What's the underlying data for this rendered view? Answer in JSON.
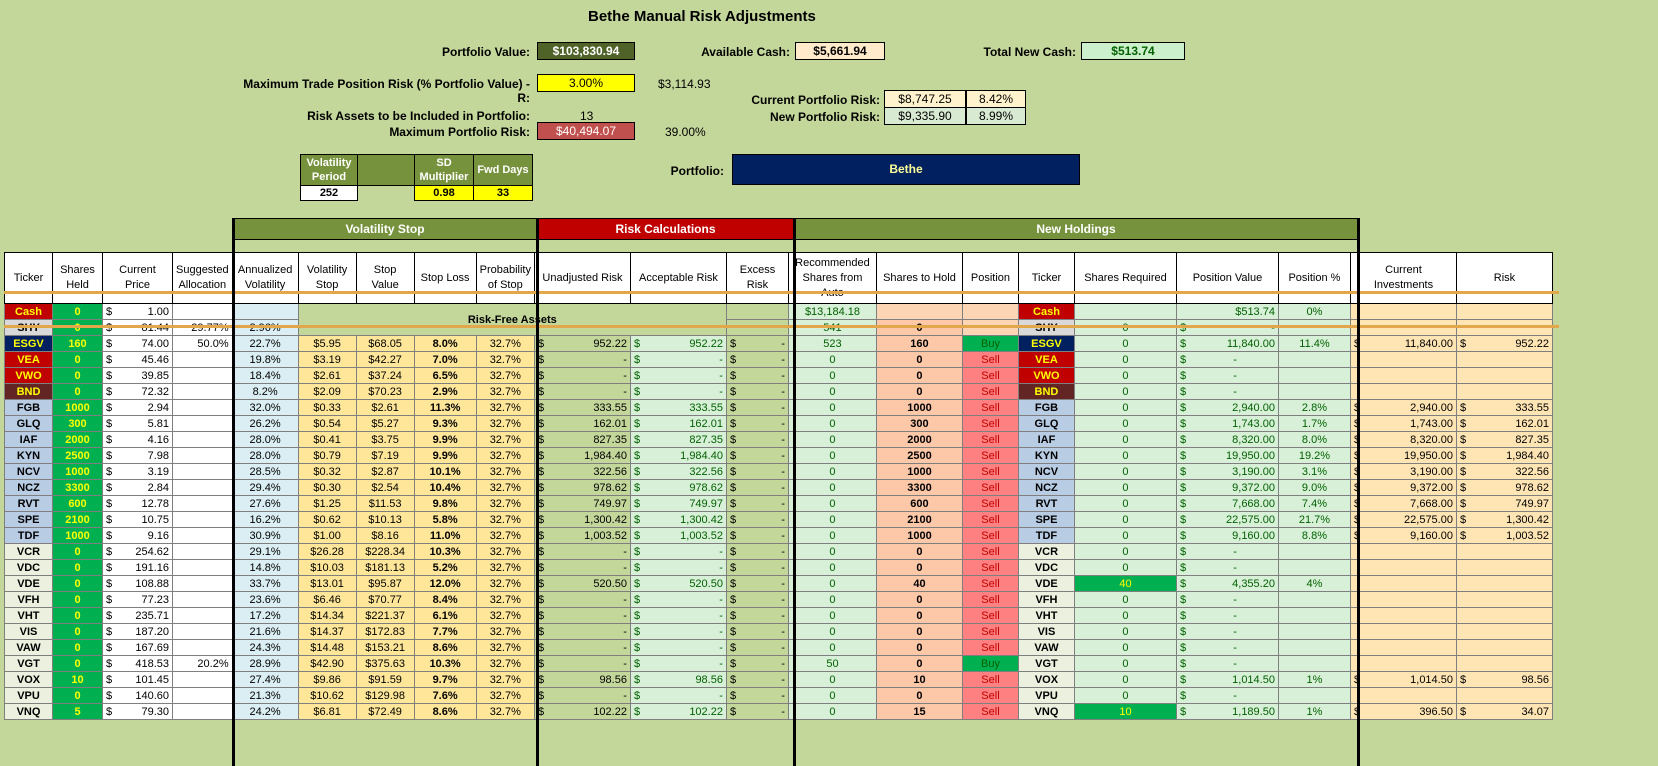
{
  "title": "Bethe Manual Risk Adjustments",
  "summary": {
    "portfolio_value_label": "Portfolio Value:",
    "portfolio_value": "$103,830.94",
    "available_cash_label": "Available Cash:",
    "available_cash": "$5,661.94",
    "total_new_cash_label": "Total New Cash:",
    "total_new_cash": "$513.74",
    "max_trade_risk_label": "Maximum Trade Position Risk (% Portfolio Value) - R:",
    "max_trade_risk_pct": "3.00%",
    "max_trade_risk_amt": "$3,114.93",
    "current_risk_label": "Current Portfolio Risk:",
    "current_risk_amt": "$8,747.25",
    "current_risk_pct": "8.42%",
    "new_risk_label": "New Portfolio Risk:",
    "new_risk_amt": "$9,335.90",
    "new_risk_pct": "8.99%",
    "risk_assets_label": "Risk Assets to be Included in Portfolio:",
    "risk_assets_count": "13",
    "max_portfolio_risk_label": "Maximum Portfolio Risk:",
    "max_portfolio_risk_amt": "$40,494.07",
    "max_portfolio_risk_pct": "39.00%",
    "portfolio_label": "Portfolio:",
    "portfolio_name": "Bethe"
  },
  "params": {
    "vol_period_label": "Volatility Period",
    "vol_period": "252",
    "sd_label": "SD Multiplier",
    "sd": "0.98",
    "fwd_label": "Fwd Days",
    "fwd": "33"
  },
  "sections": {
    "vol_stop": "Volatility Stop",
    "risk_calc": "Risk Calculations",
    "new_holdings": "New Holdings",
    "risk_free": "Risk-Free Assets"
  },
  "headers": [
    "Ticker",
    "Shares Held",
    "Current Price",
    "Suggested Allocation",
    "Annualized Volatility",
    "Volatility Stop",
    "Stop Value",
    "Stop Loss",
    "Probability of Stop",
    "Unadjusted Risk",
    "Acceptable Risk",
    "Excess Risk",
    "Recommended Shares from Auto",
    "Shares to Hold",
    "Position",
    "Ticker",
    "Shares Required",
    "Position Value",
    "Position %",
    "Current Investments",
    "Risk"
  ],
  "cash_row": {
    "ticker": "Cash",
    "held": "0",
    "price": "1.00",
    "rec": "$13,184.18",
    "ticker2": "Cash",
    "pos_value": "$513.74",
    "pos_pct": "0%"
  },
  "shy_row": {
    "ticker": "SHY",
    "held": "0",
    "price": "81.44",
    "alloc": "29.77%",
    "vol": "2.96%",
    "rec": "541",
    "hold": "0",
    "ticker2": "SHY",
    "req": "0",
    "pos_value": "-"
  },
  "rows": [
    {
      "t": "ESGV",
      "c": "dk",
      "h": "160",
      "p": "74.00",
      "a": "50.0%",
      "v": "22.7%",
      "vs": "$5.95",
      "sv": "$68.05",
      "sl": "8.0%",
      "pr": "32.7%",
      "ur": "952.22",
      "ar": "952.22",
      "er": "-",
      "rec": "523",
      "hold": "160",
      "pos": "Buy",
      "req": "0",
      "pv": "11,840.00",
      "pp": "11.4%",
      "ci": "11,840.00",
      "r": "952.22"
    },
    {
      "t": "VEA",
      "c": "red",
      "h": "0",
      "p": "45.46",
      "a": "",
      "v": "19.8%",
      "vs": "$3.19",
      "sv": "$42.27",
      "sl": "7.0%",
      "pr": "32.7%",
      "ur": "-",
      "ar": "-",
      "er": "-",
      "rec": "0",
      "hold": "0",
      "pos": "Sell",
      "req": "0",
      "pv": "-",
      "pp": "",
      "ci": "",
      "r": ""
    },
    {
      "t": "VWO",
      "c": "red",
      "h": "0",
      "p": "39.85",
      "a": "",
      "v": "18.4%",
      "vs": "$2.61",
      "sv": "$37.24",
      "sl": "6.5%",
      "pr": "32.7%",
      "ur": "-",
      "ar": "-",
      "er": "-",
      "rec": "0",
      "hold": "0",
      "pos": "Sell",
      "req": "0",
      "pv": "-",
      "pp": "",
      "ci": "",
      "r": ""
    },
    {
      "t": "BND",
      "c": "brn",
      "h": "0",
      "p": "72.32",
      "a": "",
      "v": "8.2%",
      "vs": "$2.09",
      "sv": "$70.23",
      "sl": "2.9%",
      "pr": "32.7%",
      "ur": "-",
      "ar": "-",
      "er": "-",
      "rec": "0",
      "hold": "0",
      "pos": "Sell",
      "req": "0",
      "pv": "-",
      "pp": "",
      "ci": "",
      "r": ""
    },
    {
      "t": "FGB",
      "c": "blue",
      "h": "1000",
      "p": "2.94",
      "a": "",
      "v": "32.0%",
      "vs": "$0.33",
      "sv": "$2.61",
      "sl": "11.3%",
      "pr": "32.7%",
      "ur": "333.55",
      "ar": "333.55",
      "er": "-",
      "rec": "0",
      "hold": "1000",
      "pos": "Sell",
      "req": "0",
      "pv": "2,940.00",
      "pp": "2.8%",
      "ci": "2,940.00",
      "r": "333.55"
    },
    {
      "t": "GLQ",
      "c": "blue",
      "h": "300",
      "p": "5.81",
      "a": "",
      "v": "26.2%",
      "vs": "$0.54",
      "sv": "$5.27",
      "sl": "9.3%",
      "pr": "32.7%",
      "ur": "162.01",
      "ar": "162.01",
      "er": "-",
      "rec": "0",
      "hold": "300",
      "pos": "Sell",
      "req": "0",
      "pv": "1,743.00",
      "pp": "1.7%",
      "ci": "1,743.00",
      "r": "162.01"
    },
    {
      "t": "IAF",
      "c": "blue",
      "h": "2000",
      "p": "4.16",
      "a": "",
      "v": "28.0%",
      "vs": "$0.41",
      "sv": "$3.75",
      "sl": "9.9%",
      "pr": "32.7%",
      "ur": "827.35",
      "ar": "827.35",
      "er": "-",
      "rec": "0",
      "hold": "2000",
      "pos": "Sell",
      "req": "0",
      "pv": "8,320.00",
      "pp": "8.0%",
      "ci": "8,320.00",
      "r": "827.35"
    },
    {
      "t": "KYN",
      "c": "blue",
      "h": "2500",
      "p": "7.98",
      "a": "",
      "v": "28.0%",
      "vs": "$0.79",
      "sv": "$7.19",
      "sl": "9.9%",
      "pr": "32.7%",
      "ur": "1,984.40",
      "ar": "1,984.40",
      "er": "-",
      "rec": "0",
      "hold": "2500",
      "pos": "Sell",
      "req": "0",
      "pv": "19,950.00",
      "pp": "19.2%",
      "ci": "19,950.00",
      "r": "1,984.40"
    },
    {
      "t": "NCV",
      "c": "blue",
      "h": "1000",
      "p": "3.19",
      "a": "",
      "v": "28.5%",
      "vs": "$0.32",
      "sv": "$2.87",
      "sl": "10.1%",
      "pr": "32.7%",
      "ur": "322.56",
      "ar": "322.56",
      "er": "-",
      "rec": "0",
      "hold": "1000",
      "pos": "Sell",
      "req": "0",
      "pv": "3,190.00",
      "pp": "3.1%",
      "ci": "3,190.00",
      "r": "322.56"
    },
    {
      "t": "NCZ",
      "c": "blue",
      "h": "3300",
      "p": "2.84",
      "a": "",
      "v": "29.4%",
      "vs": "$0.30",
      "sv": "$2.54",
      "sl": "10.4%",
      "pr": "32.7%",
      "ur": "978.62",
      "ar": "978.62",
      "er": "-",
      "rec": "0",
      "hold": "3300",
      "pos": "Sell",
      "req": "0",
      "pv": "9,372.00",
      "pp": "9.0%",
      "ci": "9,372.00",
      "r": "978.62"
    },
    {
      "t": "RVT",
      "c": "blue",
      "h": "600",
      "p": "12.78",
      "a": "",
      "v": "27.6%",
      "vs": "$1.25",
      "sv": "$11.53",
      "sl": "9.8%",
      "pr": "32.7%",
      "ur": "749.97",
      "ar": "749.97",
      "er": "-",
      "rec": "0",
      "hold": "600",
      "pos": "Sell",
      "req": "0",
      "pv": "7,668.00",
      "pp": "7.4%",
      "ci": "7,668.00",
      "r": "749.97"
    },
    {
      "t": "SPE",
      "c": "blue",
      "h": "2100",
      "p": "10.75",
      "a": "",
      "v": "16.2%",
      "vs": "$0.62",
      "sv": "$10.13",
      "sl": "5.8%",
      "pr": "32.7%",
      "ur": "1,300.42",
      "ar": "1,300.42",
      "er": "-",
      "rec": "0",
      "hold": "2100",
      "pos": "Sell",
      "req": "0",
      "pv": "22,575.00",
      "pp": "21.7%",
      "ci": "22,575.00",
      "r": "1,300.42"
    },
    {
      "t": "TDF",
      "c": "blue",
      "h": "1000",
      "p": "9.16",
      "a": "",
      "v": "30.9%",
      "vs": "$1.00",
      "sv": "$8.16",
      "sl": "11.0%",
      "pr": "32.7%",
      "ur": "1,003.52",
      "ar": "1,003.52",
      "er": "-",
      "rec": "0",
      "hold": "1000",
      "pos": "Sell",
      "req": "0",
      "pv": "9,160.00",
      "pp": "8.8%",
      "ci": "9,160.00",
      "r": "1,003.52"
    },
    {
      "t": "VCR",
      "c": "lt",
      "h": "0",
      "p": "254.62",
      "a": "",
      "v": "29.1%",
      "vs": "$26.28",
      "sv": "$228.34",
      "sl": "10.3%",
      "pr": "32.7%",
      "ur": "-",
      "ar": "-",
      "er": "-",
      "rec": "0",
      "hold": "0",
      "pos": "Sell",
      "req": "0",
      "pv": "-",
      "pp": "",
      "ci": "",
      "r": ""
    },
    {
      "t": "VDC",
      "c": "lt",
      "h": "0",
      "p": "191.16",
      "a": "",
      "v": "14.8%",
      "vs": "$10.03",
      "sv": "$181.13",
      "sl": "5.2%",
      "pr": "32.7%",
      "ur": "-",
      "ar": "-",
      "er": "-",
      "rec": "0",
      "hold": "0",
      "pos": "Sell",
      "req": "0",
      "pv": "-",
      "pp": "",
      "ci": "",
      "r": ""
    },
    {
      "t": "VDE",
      "c": "lt",
      "h": "0",
      "p": "108.88",
      "a": "",
      "v": "33.7%",
      "vs": "$13.01",
      "sv": "$95.87",
      "sl": "12.0%",
      "pr": "32.7%",
      "ur": "520.50",
      "ar": "520.50",
      "er": "-",
      "rec": "0",
      "hold": "40",
      "pos": "Sell",
      "req": "40",
      "reqhl": true,
      "pv": "4,355.20",
      "pp": "4%",
      "ci": "",
      "r": ""
    },
    {
      "t": "VFH",
      "c": "lt",
      "h": "0",
      "p": "77.23",
      "a": "",
      "v": "23.6%",
      "vs": "$6.46",
      "sv": "$70.77",
      "sl": "8.4%",
      "pr": "32.7%",
      "ur": "-",
      "ar": "-",
      "er": "-",
      "rec": "0",
      "hold": "0",
      "pos": "Sell",
      "req": "0",
      "pv": "-",
      "pp": "",
      "ci": "",
      "r": ""
    },
    {
      "t": "VHT",
      "c": "lt",
      "h": "0",
      "p": "235.71",
      "a": "",
      "v": "17.2%",
      "vs": "$14.34",
      "sv": "$221.37",
      "sl": "6.1%",
      "pr": "32.7%",
      "ur": "-",
      "ar": "-",
      "er": "-",
      "rec": "0",
      "hold": "0",
      "pos": "Sell",
      "req": "0",
      "pv": "-",
      "pp": "",
      "ci": "",
      "r": ""
    },
    {
      "t": "VIS",
      "c": "lt",
      "h": "0",
      "p": "187.20",
      "a": "",
      "v": "21.6%",
      "vs": "$14.37",
      "sv": "$172.83",
      "sl": "7.7%",
      "pr": "32.7%",
      "ur": "-",
      "ar": "-",
      "er": "-",
      "rec": "0",
      "hold": "0",
      "pos": "Sell",
      "req": "0",
      "pv": "-",
      "pp": "",
      "ci": "",
      "r": ""
    },
    {
      "t": "VAW",
      "c": "lt",
      "h": "0",
      "p": "167.69",
      "a": "",
      "v": "24.3%",
      "vs": "$14.48",
      "sv": "$153.21",
      "sl": "8.6%",
      "pr": "32.7%",
      "ur": "-",
      "ar": "-",
      "er": "-",
      "rec": "0",
      "hold": "0",
      "pos": "Sell",
      "req": "0",
      "pv": "-",
      "pp": "",
      "ci": "",
      "r": ""
    },
    {
      "t": "VGT",
      "c": "lt",
      "h": "0",
      "p": "418.53",
      "a": "20.2%",
      "v": "28.9%",
      "vs": "$42.90",
      "sv": "$375.63",
      "sl": "10.3%",
      "pr": "32.7%",
      "ur": "-",
      "ar": "-",
      "er": "-",
      "rec": "50",
      "hold": "0",
      "pos": "Buy",
      "req": "0",
      "pv": "-",
      "pp": "",
      "ci": "",
      "r": ""
    },
    {
      "t": "VOX",
      "c": "lt",
      "h": "10",
      "p": "101.45",
      "a": "",
      "v": "27.4%",
      "vs": "$9.86",
      "sv": "$91.59",
      "sl": "9.7%",
      "pr": "32.7%",
      "ur": "98.56",
      "ar": "98.56",
      "er": "-",
      "rec": "0",
      "hold": "10",
      "pos": "Sell",
      "req": "0",
      "pv": "1,014.50",
      "pp": "1%",
      "ci": "1,014.50",
      "r": "98.56"
    },
    {
      "t": "VPU",
      "c": "lt",
      "h": "0",
      "p": "140.60",
      "a": "",
      "v": "21.3%",
      "vs": "$10.62",
      "sv": "$129.98",
      "sl": "7.6%",
      "pr": "32.7%",
      "ur": "-",
      "ar": "-",
      "er": "-",
      "rec": "0",
      "hold": "0",
      "pos": "Sell",
      "req": "0",
      "pv": "-",
      "pp": "",
      "ci": "",
      "r": ""
    },
    {
      "t": "VNQ",
      "c": "lt",
      "h": "5",
      "p": "79.30",
      "a": "",
      "v": "24.2%",
      "vs": "$6.81",
      "sv": "$72.49",
      "sl": "8.6%",
      "pr": "32.7%",
      "ur": "102.22",
      "ar": "102.22",
      "er": "-",
      "rec": "0",
      "hold": "15",
      "pos": "Sell",
      "req": "10",
      "reqhl": true,
      "pv": "1,189.50",
      "pp": "1%",
      "ci": "396.50",
      "r": "34.07"
    }
  ]
}
